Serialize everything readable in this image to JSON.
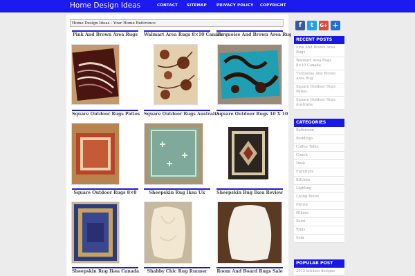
{
  "header": {
    "site_title": "Home Design Ideas",
    "nav": [
      "CONTACT",
      "SITEMAP",
      "PRIVACY POLICY",
      "COPYRIGHT"
    ]
  },
  "breadcrumb": "Home Design Ideas - Your Home Reference",
  "posts": [
    {
      "title": "Pink And Brown Area Rugs",
      "image": "brown-striped-rug"
    },
    {
      "title": "Walmart Area Rugs 8×10 Canada",
      "image": "floral-beige-rug"
    },
    {
      "title": "Turquoise And Brown Area Rug",
      "image": "turquoise-swirl-rug"
    },
    {
      "title": "Square Outdoor Rugs Patios",
      "image": "orange-bordered-rug"
    },
    {
      "title": "Square Outdoor Rugs Australia",
      "image": "green-dragonfly-rug"
    },
    {
      "title": "Square Outdoor Rugs 10 X 10",
      "image": "persian-medallion-rug"
    },
    {
      "title": "Square Outdoor Rugs 8×8",
      "image": "blue-ornate-rug"
    },
    {
      "title": "Sheepskin Rug Ikea Uk",
      "image": "sheepskin-rug-beige"
    },
    {
      "title": "Sheepskin Rug Ikea Review",
      "image": "sheepskin-rug-white"
    },
    {
      "title": "Sheepskin Rug Ikea Canada",
      "image": null
    },
    {
      "title": "Shabby Chic Rug Runner",
      "image": null
    },
    {
      "title": "Room And Board Rugs Sale",
      "image": null
    }
  ],
  "sidebar": {
    "social": [
      {
        "label": "f",
        "color": "#3b5998",
        "icon": "facebook-icon"
      },
      {
        "label": "t",
        "color": "#1da1f2",
        "icon": "twitter-icon"
      },
      {
        "label": "G+",
        "color": "#dd4b39",
        "icon": "google-plus-icon"
      },
      {
        "label": "+",
        "color": "#1e6fd9",
        "icon": "share-icon"
      }
    ],
    "recent_posts": {
      "heading": "RECENT POSTS",
      "items": [
        "Pink And Brown Area Rugs",
        "Walmart Area Rugs 8×10 Canada",
        "Turquoise And Brown Area Rug",
        "Square Outdoor Rugs Patios",
        "Square Outdoor Rugs Australia"
      ]
    },
    "categories": {
      "heading": "CATEGORIES",
      "items": [
        "Bathroom",
        "Beddings",
        "Coffee Table",
        "Couch",
        "Desk",
        "Furniture",
        "Kitchen",
        "Lighting",
        "Living Room",
        "Mirror",
        "Others",
        "Paint",
        "Rugs",
        "Sofa"
      ]
    },
    "popular": {
      "heading": "POPULAR POST",
      "items": [
        "2015 kitchen designs"
      ]
    }
  },
  "colors": {
    "accent": "#1b1bf0",
    "background": "#ececec"
  }
}
